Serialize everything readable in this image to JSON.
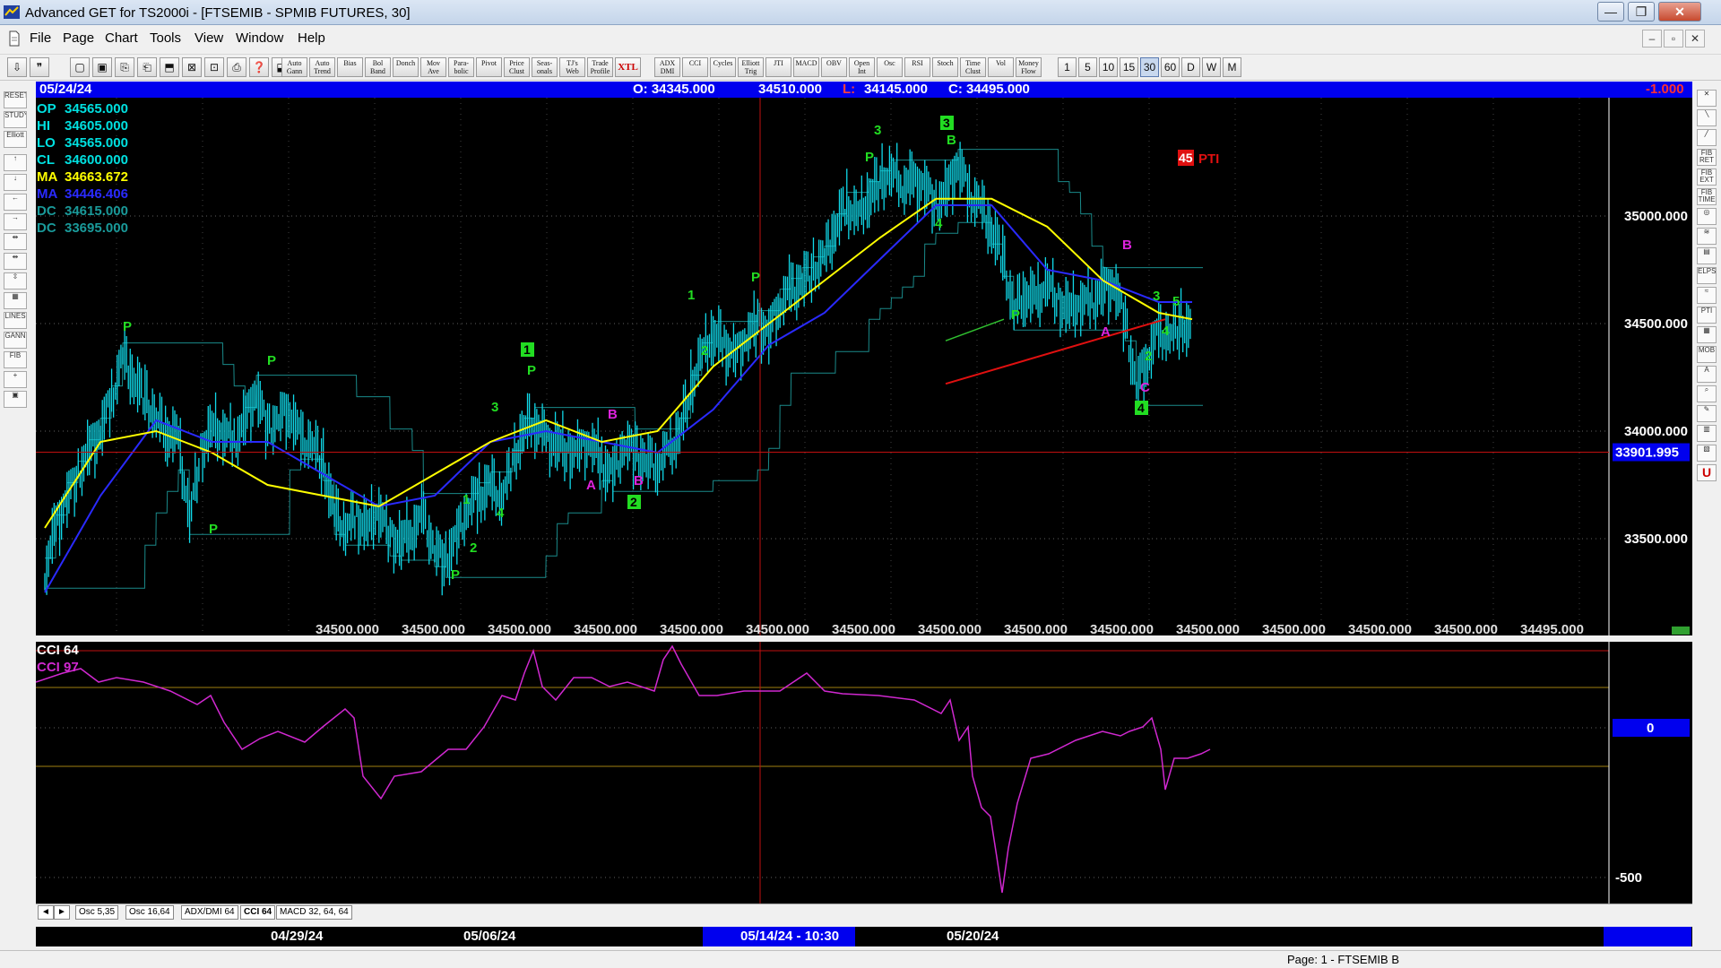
{
  "window": {
    "title": "Advanced GET for TS2000i - [FTSEMIB - SPMIB FUTURES, 30]",
    "min": "—",
    "max": "❐",
    "close": "✕"
  },
  "menu": [
    "File",
    "Page",
    "Chart",
    "Tools",
    "View",
    "Window",
    "Help"
  ],
  "mdi_controls": [
    "–",
    "▫",
    "✕"
  ],
  "toolbar_groups": {
    "studies": [
      "Auto Gann",
      "Auto Trend",
      "Bias",
      "Bol Band",
      "Donch",
      "Mov Ave",
      "Para- bolic",
      "Pivot",
      "Price Clust",
      "Seas- onals",
      "TJ's Web",
      "Trade Profile",
      "XTL"
    ],
    "oscillators": [
      "ADX DMI",
      "CCI",
      "Cycles",
      "Elliott Trig",
      "JTI",
      "MACD",
      "OBV",
      "Open Int",
      "Osc",
      "RSI",
      "Stoch",
      "Time Clust",
      "Vol",
      "Money Flow"
    ],
    "timeframes": [
      "1",
      "5",
      "10",
      "15",
      "30",
      "60",
      "D",
      "W",
      "M"
    ],
    "selected_timeframe": "30"
  },
  "left_tools": [
    "RESET",
    "STUDY",
    "Elliott",
    "↑",
    "↓",
    "←",
    "→",
    "⇹",
    "⇹",
    "⇳",
    "▦",
    "LINES",
    "GANN",
    "FIB",
    "+",
    "▣"
  ],
  "right_tools": [
    "✕",
    "╲",
    "╱",
    "FIB RET",
    "FIB EXT",
    "FIB TIME",
    "◎",
    "≋",
    "▤",
    "ELPS",
    "≈",
    "PTI",
    "▦",
    "MOB",
    "A",
    "⌕",
    "✎",
    "▥",
    "▧",
    "U"
  ],
  "info": {
    "date": "05/24/24",
    "open": "O: 34345.000",
    "high": "34510.000",
    "low_label": "L:",
    "low": "34145.000",
    "close": "C: 34495.000",
    "change": "-1.000"
  },
  "legend": [
    {
      "label": "OP",
      "value": "34565.000",
      "color": "#00e0e0"
    },
    {
      "label": "HI",
      "value": "34605.000",
      "color": "#00e0e0"
    },
    {
      "label": "LO",
      "value": "34565.000",
      "color": "#00e0e0"
    },
    {
      "label": "CL",
      "value": "34600.000",
      "color": "#00e0e0"
    },
    {
      "label": "MA",
      "value": "34663.672",
      "color": "#ffff00"
    },
    {
      "label": "MA",
      "value": "34446.406",
      "color": "#2a2aff"
    },
    {
      "label": "DC",
      "value": "34615.000",
      "color": "#1a9a9a"
    },
    {
      "label": "DC",
      "value": "33695.000",
      "color": "#1a9a9a"
    }
  ],
  "price_axis": {
    "labels": [
      "35000.000",
      "34500.000",
      "34000.000",
      "33500.000"
    ],
    "current": "33901.995"
  },
  "bottom_values": [
    "34500.000",
    "34500.000",
    "34500.000",
    "34500.000",
    "34500.000",
    "34500.000",
    "34500.000",
    "34500.000",
    "34500.000",
    "34500.000",
    "34500.000",
    "34500.000",
    "34500.000",
    "34500.000",
    "34495.000"
  ],
  "pti": {
    "value": "45",
    "label": "PTI"
  },
  "wave_labels": [
    {
      "t": "P",
      "c": "#22dd22"
    },
    {
      "t": "P",
      "c": "#22dd22"
    },
    {
      "t": "P",
      "c": "#22dd22"
    },
    {
      "t": "P",
      "c": "#22dd22"
    },
    {
      "t": "2",
      "c": "#22dd22"
    },
    {
      "t": "1",
      "c": "#22dd22"
    },
    {
      "t": "3",
      "c": "#22dd22"
    },
    {
      "t": "4",
      "c": "#22dd22"
    },
    {
      "t": "5",
      "c": "#22dd22"
    },
    {
      "t": "P",
      "c": "#22dd22"
    },
    {
      "t": "A",
      "c": "#dd22dd"
    },
    {
      "t": "B",
      "c": "#dd22dd"
    },
    {
      "t": "B",
      "c": "#dd22dd"
    },
    {
      "t": "P",
      "c": "#22dd22"
    },
    {
      "t": "1",
      "c": "#22dd22"
    },
    {
      "t": "2",
      "c": "#22dd22"
    },
    {
      "t": "3",
      "c": "#22dd22"
    },
    {
      "t": "P",
      "c": "#22dd22"
    },
    {
      "t": "4",
      "c": "#22dd22"
    },
    {
      "t": "B",
      "c": "#22dd22"
    },
    {
      "t": "P",
      "c": "#22dd22"
    },
    {
      "t": "B",
      "c": "#dd22dd"
    },
    {
      "t": "A",
      "c": "#dd22dd"
    },
    {
      "t": "3",
      "c": "#22dd22"
    },
    {
      "t": "5",
      "c": "#22dd22"
    },
    {
      "t": "4",
      "c": "#22dd22"
    },
    {
      "t": "2",
      "c": "#22dd22"
    },
    {
      "t": "C",
      "c": "#dd22dd"
    }
  ],
  "wave_boxes": [
    "1",
    "2",
    "3",
    "4"
  ],
  "cci": {
    "name1": "CCI 64",
    "name2": "CCI  97",
    "axis": [
      "0",
      "-500"
    ]
  },
  "tabs": [
    "Osc 5,35",
    "Osc 16,64",
    "ADX/DMI 64",
    "CCI 64",
    "MACD 32, 64, 64"
  ],
  "tab_arrows": [
    "◄",
    "►"
  ],
  "dates": {
    "d1": "04/29/24",
    "d2": "05/06/24",
    "cursor": "05/14/24 - 10:30",
    "d3": "05/20/24"
  },
  "status": "Page: 1 - FTSEMIB B",
  "chart_data": {
    "type": "line",
    "title": "FTSEMIB - SPMIB FUTURES, 30",
    "x_range": [
      "04/24/24",
      "05/24/24"
    ],
    "ylim": [
      33100,
      35500
    ],
    "series": [
      {
        "name": "",
        "x": [
          0,
          10,
          20,
          30,
          40,
          50,
          60,
          70,
          80,
          90,
          100,
          110,
          120,
          130,
          140,
          150,
          160,
          170,
          180,
          190,
          200,
          210,
          220,
          230,
          240,
          250,
          260,
          270,
          280,
          290,
          300,
          310,
          320,
          330,
          340,
          350,
          360,
          370,
          380,
          390,
          400,
          410,
          420,
          430,
          440,
          450,
          460,
          470,
          480,
          490,
          500,
          510,
          520,
          530,
          540,
          550,
          560,
          570,
          580,
          590,
          600,
          610,
          620,
          630,
          640,
          650,
          660,
          670,
          680,
          690,
          700,
          710,
          720,
          730,
          740,
          750,
          760,
          770,
          780,
          790,
          800,
          810,
          820,
          830,
          840,
          850,
          860,
          870,
          880,
          890,
          900,
          910,
          920,
          930,
          940,
          950,
          960,
          970,
          980,
          990,
          1000,
          1010,
          1020,
          1030
        ],
        "y": [
          33350,
          33550,
          33700,
          33800,
          33900,
          34000,
          34150,
          34350,
          34250,
          34150,
          34050,
          34000,
          33950,
          33600,
          33900,
          34000,
          34000,
          33950,
          34050,
          34200,
          34000,
          34050,
          34100,
          33950,
          33950,
          33850,
          33600,
          33550,
          33600,
          33550,
          33650,
          33500,
          33480,
          33550,
          33600,
          33450,
          33400,
          33500,
          33650,
          33700,
          33750,
          33700,
          33850,
          34000,
          34050,
          33950,
          33950,
          33900,
          33900,
          33950,
          33850,
          33800,
          33950,
          33900,
          33850,
          33850,
          33900,
          34000,
          34200,
          34350,
          34450,
          34400,
          34350,
          34450,
          34500,
          34450,
          34600,
          34650,
          34700,
          34750,
          34800,
          34950,
          35050,
          35000,
          35100,
          35150,
          35200,
          35150,
          35150,
          35150,
          35050,
          35100,
          35250,
          35100,
          35050,
          34950,
          34800,
          34550,
          34650,
          34600,
          34700,
          34600,
          34550,
          34600,
          34600,
          34650,
          34700,
          34500,
          34200,
          34350,
          34450,
          34450,
          34500,
          34450
        ]
      },
      {
        "name": "",
        "x": [
          0,
          50,
          100,
          150,
          200,
          250,
          300,
          350,
          400,
          450,
          500,
          550,
          600,
          650,
          700,
          750,
          800,
          850,
          900,
          950,
          1000,
          1030
        ],
        "y": [
          33550,
          33950,
          34000,
          33900,
          33750,
          33700,
          33650,
          33800,
          33950,
          34050,
          33950,
          34000,
          34300,
          34500,
          34700,
          34900,
          35080,
          35080,
          34950,
          34700,
          34550,
          34520
        ]
      },
      {
        "name": "",
        "x": [
          0,
          50,
          100,
          150,
          200,
          250,
          300,
          350,
          400,
          450,
          500,
          550,
          600,
          650,
          700,
          750,
          800,
          850,
          900,
          950,
          1000,
          1030
        ],
        "y": [
          33250,
          33700,
          34050,
          33950,
          33950,
          33800,
          33650,
          33700,
          33950,
          34000,
          33950,
          33900,
          34100,
          34400,
          34550,
          34800,
          35050,
          35050,
          34750,
          34700,
          34600,
          34600
        ]
      }
    ]
  }
}
